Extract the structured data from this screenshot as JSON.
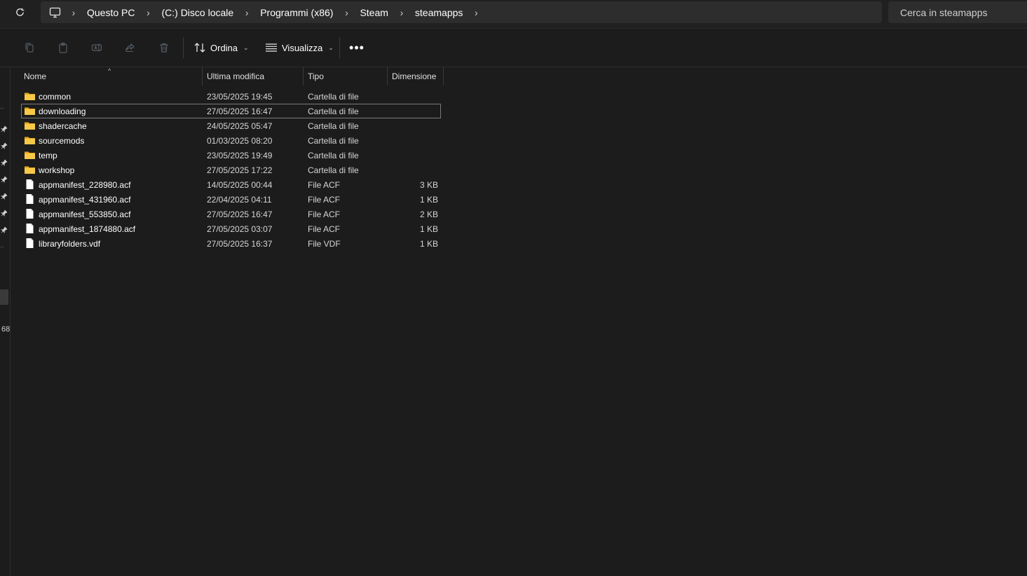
{
  "address_bar": {
    "refresh_icon": "refresh-icon",
    "root_icon": "pc-icon",
    "breadcrumb": [
      {
        "label": "Questo PC"
      },
      {
        "label": "(C:) Disco locale"
      },
      {
        "label": "Programmi (x86)"
      },
      {
        "label": "Steam"
      },
      {
        "label": "steamapps"
      }
    ],
    "search_placeholder": "Cerca in steamapps"
  },
  "command_bar": {
    "icons": [
      "copy-icon",
      "paste-icon",
      "rename-icon",
      "share-icon",
      "delete-icon"
    ],
    "sort_label": "Ordina",
    "view_label": "Visualizza",
    "more_label": "•••"
  },
  "nav": {
    "partial_text": "68"
  },
  "columns": {
    "name": "Nome",
    "modified": "Ultima modifica",
    "type": "Tipo",
    "size": "Dimensione"
  },
  "files": [
    {
      "name": "common",
      "modified": "23/05/2025 19:45",
      "type": "Cartella di file",
      "size": "",
      "icon": "folder-icon"
    },
    {
      "name": "downloading",
      "modified": "27/05/2025 16:47",
      "type": "Cartella di file",
      "size": "",
      "icon": "folder-icon"
    },
    {
      "name": "shadercache",
      "modified": "24/05/2025 05:47",
      "type": "Cartella di file",
      "size": "",
      "icon": "folder-icon"
    },
    {
      "name": "sourcemods",
      "modified": "01/03/2025 08:20",
      "type": "Cartella di file",
      "size": "",
      "icon": "folder-icon"
    },
    {
      "name": "temp",
      "modified": "23/05/2025 19:49",
      "type": "Cartella di file",
      "size": "",
      "icon": "folder-icon"
    },
    {
      "name": "workshop",
      "modified": "27/05/2025 17:22",
      "type": "Cartella di file",
      "size": "",
      "icon": "folder-icon"
    },
    {
      "name": "appmanifest_228980.acf",
      "modified": "14/05/2025 00:44",
      "type": "File ACF",
      "size": "3 KB",
      "icon": "file-icon"
    },
    {
      "name": "appmanifest_431960.acf",
      "modified": "22/04/2025 04:11",
      "type": "File ACF",
      "size": "1 KB",
      "icon": "file-icon"
    },
    {
      "name": "appmanifest_553850.acf",
      "modified": "27/05/2025 16:47",
      "type": "File ACF",
      "size": "2 KB",
      "icon": "file-icon"
    },
    {
      "name": "appmanifest_1874880.acf",
      "modified": "27/05/2025 03:07",
      "type": "File ACF",
      "size": "1 KB",
      "icon": "file-icon"
    },
    {
      "name": "libraryfolders.vdf",
      "modified": "27/05/2025 16:37",
      "type": "File VDF",
      "size": "1 KB",
      "icon": "file-icon"
    }
  ],
  "colors": {
    "background": "#1c1c1c",
    "toolbar": "#202020",
    "input": "#2d2d2d",
    "folder": "#f0b429"
  }
}
